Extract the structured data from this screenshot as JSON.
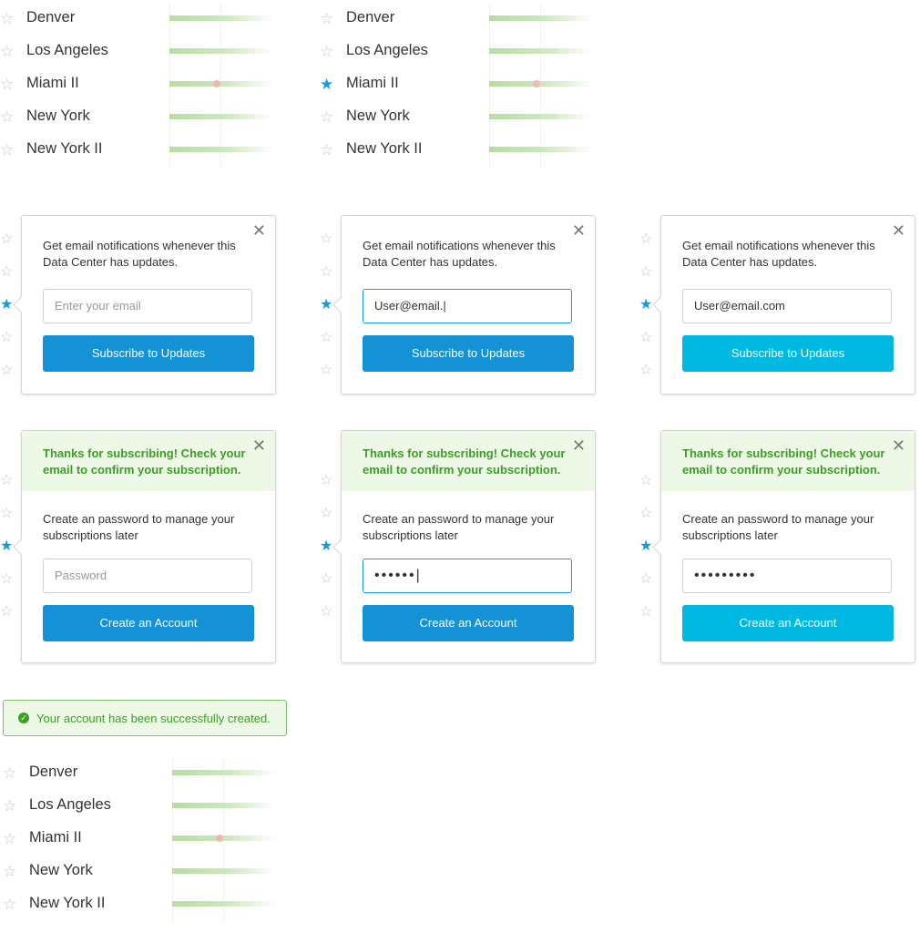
{
  "data_centers": [
    "Denver",
    "Los Angeles",
    "Miami II",
    "New York",
    "New York II"
  ],
  "lists": [
    {
      "starred": [
        false,
        false,
        false,
        false,
        false
      ]
    },
    {
      "starred": [
        false,
        false,
        true,
        false,
        false
      ]
    },
    {
      "starred": [
        false,
        false,
        false,
        false,
        false
      ]
    }
  ],
  "subscribe": {
    "description": "Get email notifications whenever this Data Center has updates.",
    "email_placeholder": "Enter your email",
    "button_label": "Subscribe to Updates",
    "states": [
      {
        "email": ""
      },
      {
        "email": "User@email."
      },
      {
        "email": "User@email.com"
      }
    ]
  },
  "account": {
    "thanks": "Thanks for subscribing! Check your email to confirm your subscription.",
    "description": "Create an password to manage your subscriptions later",
    "password_placeholder": "Password",
    "button_label": "Create an Account",
    "states": [
      {
        "password_mask": ""
      },
      {
        "password_mask": "••••••"
      },
      {
        "password_mask": "•••••••••"
      }
    ]
  },
  "alert": {
    "message": "Your account has been successfully created."
  },
  "icons": {
    "star": "star-icon",
    "close": "close-icon",
    "check": "check-circle-icon"
  },
  "colors": {
    "primary": "#1592d6",
    "primary_hover": "#00b9e2",
    "success": "#3aa023",
    "star_active": "#1a9ad6"
  }
}
